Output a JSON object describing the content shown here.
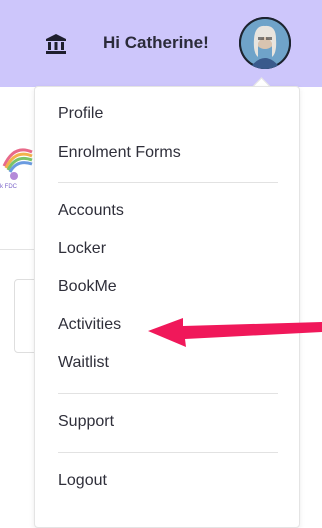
{
  "header": {
    "greeting": "Hi Catherine!",
    "bank_icon": "bank-icon",
    "background_color": "#cdc6fb"
  },
  "avatar": {
    "icon": "user-avatar"
  },
  "background": {
    "caption": "k FDC"
  },
  "menu": {
    "groups": [
      [
        "Profile",
        "Enrolment Forms"
      ],
      [
        "Accounts",
        "Locker",
        "BookMe",
        "Activities",
        "Waitlist"
      ],
      [
        "Support"
      ],
      [
        "Logout"
      ]
    ]
  },
  "annotation": {
    "arrow_color": "#f0185a",
    "highlighted_item": "Activities"
  }
}
